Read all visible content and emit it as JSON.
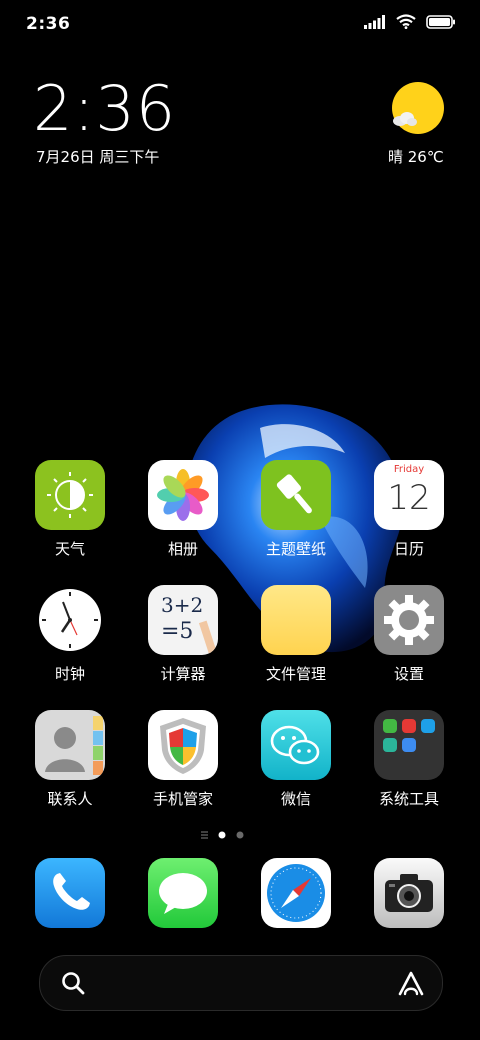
{
  "status_bar": {
    "time": "2:36"
  },
  "lockwidget": {
    "clock": "2:36",
    "date": "7月26日 周三下午",
    "weather": "晴 26℃"
  },
  "apps": [
    {
      "label": "天气",
      "icon": "weather-icon"
    },
    {
      "label": "相册",
      "icon": "photos-icon"
    },
    {
      "label": "主题壁纸",
      "icon": "themes-icon"
    },
    {
      "label": "日历",
      "icon": "calendar-icon",
      "weekday": "Friday",
      "day": "12"
    },
    {
      "label": "时钟",
      "icon": "clock-icon"
    },
    {
      "label": "计算器",
      "icon": "calculator-icon",
      "line1": "3+2",
      "line2": "=5"
    },
    {
      "label": "文件管理",
      "icon": "folder-icon"
    },
    {
      "label": "设置",
      "icon": "gear-icon"
    },
    {
      "label": "联系人",
      "icon": "contacts-icon"
    },
    {
      "label": "手机管家",
      "icon": "security-shield-icon"
    },
    {
      "label": "微信",
      "icon": "wechat-icon"
    },
    {
      "label": "系统工具",
      "icon": "system-tools-folder-icon"
    }
  ],
  "dock": [
    {
      "icon": "phone-icon"
    },
    {
      "icon": "messages-icon"
    },
    {
      "icon": "compass-browser-icon"
    },
    {
      "icon": "camera-icon"
    }
  ],
  "pager": {
    "pages": 3,
    "current": 1
  },
  "colors": {
    "weather_sun": "#ffd21a",
    "weather_green": "#8cc21f",
    "themes_green": "#7ec21f",
    "settings_gray": "#8a8a8a",
    "wechat_teal": "#22c7d6",
    "phone_blue": "#1e9fe6",
    "messages_green": "#3fd54d",
    "folder_yellow": "#ffdc6a"
  }
}
